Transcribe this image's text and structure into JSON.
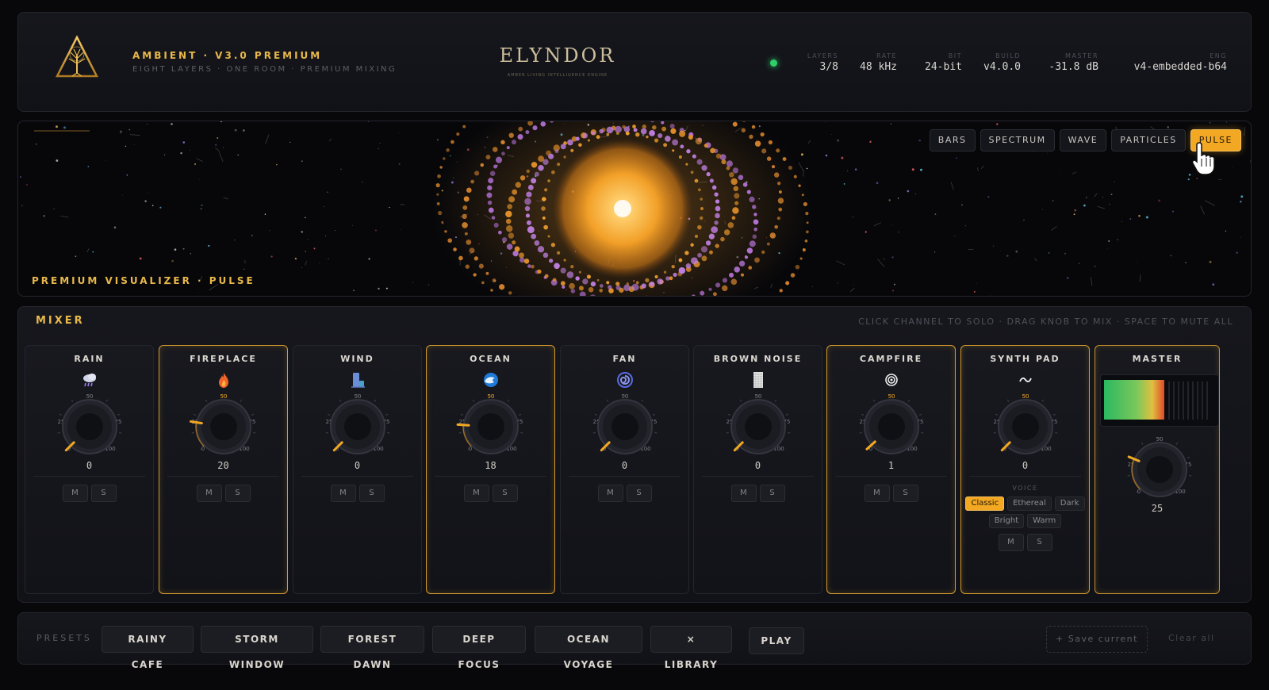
{
  "header": {
    "title": "AMBIENT · V3.0 PREMIUM",
    "subtitle": "EIGHT LAYERS · ONE ROOM · PREMIUM MIXING",
    "brand": "ELYNDOR",
    "brand_tagline": "AMBER LIVING INTELLIGENCE ENGINE",
    "status_color": "#2ecf6a",
    "stats": [
      {
        "label": "LAYERS",
        "value": "3/8"
      },
      {
        "label": "RATE",
        "value": "48 kHz"
      },
      {
        "label": "BIT",
        "value": "24-bit"
      },
      {
        "label": "BUILD",
        "value": "v4.0.0"
      },
      {
        "label": "MASTER",
        "value": "-31.8 dB"
      },
      {
        "label": "ENG",
        "value": "v4-embedded-b64"
      }
    ]
  },
  "visualizer": {
    "tabs": [
      "BARS",
      "SPECTRUM",
      "WAVE",
      "PARTICLES",
      "PULSE"
    ],
    "active_tab": "PULSE",
    "caption": "PREMIUM VISUALIZER · PULSE"
  },
  "mixer": {
    "title": "MIXER",
    "hint": "CLICK CHANNEL TO SOLO · DRAG KNOB TO MIX · SPACE TO MUTE ALL",
    "knob_ticks": [
      "25",
      "50",
      "75",
      "0",
      "100"
    ],
    "mute_label": "M",
    "solo_label": "S",
    "channels": [
      {
        "name": "RAIN",
        "icon": "rain-cloud-icon",
        "value": "0",
        "level": 0,
        "active": false
      },
      {
        "name": "FIREPLACE",
        "icon": "flame-icon",
        "value": "20",
        "level": 20,
        "active": true
      },
      {
        "name": "WIND",
        "icon": "wind-icon",
        "value": "0",
        "level": 0,
        "active": false
      },
      {
        "name": "OCEAN",
        "icon": "wave-icon",
        "value": "18",
        "level": 18,
        "active": true
      },
      {
        "name": "FAN",
        "icon": "swirl-icon",
        "value": "0",
        "level": 0,
        "active": false
      },
      {
        "name": "BROWN NOISE",
        "icon": "noise-icon",
        "value": "0",
        "level": 0,
        "active": false
      },
      {
        "name": "CAMPFIRE",
        "icon": "target-icon",
        "value": "1",
        "level": 1,
        "active": true
      },
      {
        "name": "SYNTH PAD",
        "icon": "tilde-icon",
        "value": "0",
        "level": 0,
        "active": true
      }
    ],
    "voice": {
      "label": "VOICE",
      "options": [
        "Classic",
        "Ethereal",
        "Dark",
        "Bright",
        "Warm"
      ],
      "selected": "Classic"
    },
    "master": {
      "name": "MASTER",
      "value": "25",
      "level": 25
    }
  },
  "presets": {
    "label": "PRESETS",
    "items": [
      "RAINY CAFE",
      "STORM WINDOW",
      "FOREST DAWN",
      "DEEP FOCUS",
      "OCEAN VOYAGE",
      "× LIBRARY"
    ],
    "play_label": "PLAY",
    "save_label": "+ Save current",
    "clear_label": "Clear all"
  },
  "colors": {
    "accent": "#f2a822",
    "gold": "#e8b84a",
    "active_border": "#d59a2c"
  }
}
